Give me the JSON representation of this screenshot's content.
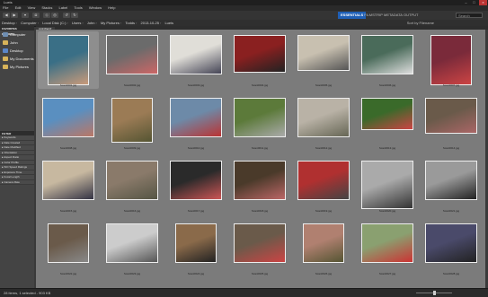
{
  "window": {
    "title": "Lueis",
    "minimize": "–",
    "maximize": "□",
    "close": "×"
  },
  "menu": [
    "File",
    "Edit",
    "View",
    "Stacks",
    "Label",
    "Tools",
    "Window",
    "Help"
  ],
  "toolbar": {
    "workspaces": [
      "ESSENTIALS",
      "FILMSTRIP",
      "METADATA",
      "OUTPUT"
    ],
    "search_placeholder": "Search"
  },
  "path": [
    "Desktop",
    "Computer",
    "Local Disk (C:)",
    "Users",
    "John",
    "My Pictures",
    "Todds",
    "2013-10-25",
    "Lueis"
  ],
  "sort": {
    "label": "Sort by Filename"
  },
  "left_panel": {
    "tabs": [
      "FAVORITES",
      "FOLDERS"
    ],
    "favorites": [
      {
        "label": "Computer",
        "color": "#6f8fb3"
      },
      {
        "label": "John",
        "color": "#d7b35a"
      },
      {
        "label": "Desktop",
        "color": "#5a86c8"
      },
      {
        "label": "My Documents",
        "color": "#d7b35a"
      },
      {
        "label": "My Pictures",
        "color": "#d7b35a"
      }
    ],
    "lower_tabs": [
      "FILTER",
      "COLLECTIONS"
    ],
    "filters": [
      "Keywords",
      "Date Created",
      "Date Modified",
      "Orientation",
      "Aspect Ratio",
      "Color Profile",
      "ISO Speed Ratings",
      "Exposure Time",
      "Focal Length",
      "Camera Raw"
    ]
  },
  "content": {
    "tab": "CONTENT"
  },
  "thumbnails": [
    {
      "name": "Scan0001.jpg",
      "w": 46,
      "h": 56,
      "colors": [
        "#3a6f86",
        "#c99a7a"
      ],
      "selected": true
    },
    {
      "name": "Scan0002.jpg",
      "w": 58,
      "h": 44,
      "colors": [
        "#6b6b6b",
        "#c66"
      ]
    },
    {
      "name": "Scan0003.jpg",
      "w": 58,
      "h": 44,
      "colors": [
        "#e0ded8",
        "#445"
      ]
    },
    {
      "name": "Scan0004.jpg",
      "w": 58,
      "h": 42,
      "colors": [
        "#8a2020",
        "#222"
      ]
    },
    {
      "name": "Scan0005.jpg",
      "w": 58,
      "h": 40,
      "colors": [
        "#c8c0b0",
        "#555"
      ]
    },
    {
      "name": "Scan0006.jpg",
      "w": 58,
      "h": 44,
      "colors": [
        "#4a6b5a",
        "#ddd"
      ]
    },
    {
      "name": "Scan0007.jpg",
      "w": 46,
      "h": 56,
      "colors": [
        "#7a2a3a",
        "#c44"
      ]
    },
    {
      "name": "Scan0008.jpg",
      "w": 58,
      "h": 44,
      "colors": [
        "#5a8fc0",
        "#b76"
      ]
    },
    {
      "name": "Scan0009.jpg",
      "w": 46,
      "h": 50,
      "colors": [
        "#9b7b55",
        "#553"
      ]
    },
    {
      "name": "Scan0010.jpg",
      "w": 58,
      "h": 44,
      "colors": [
        "#6d8aa8",
        "#b33"
      ]
    },
    {
      "name": "Scan0011.jpg",
      "w": 58,
      "h": 44,
      "colors": [
        "#5c7a3a",
        "#aaa"
      ]
    },
    {
      "name": "Scan0012.jpg",
      "w": 58,
      "h": 44,
      "colors": [
        "#b9b2a6",
        "#665"
      ]
    },
    {
      "name": "Scan0013.jpg",
      "w": 58,
      "h": 36,
      "colors": [
        "#3a6a2a",
        "#c44"
      ]
    },
    {
      "name": "Scan0014.jpg",
      "w": 58,
      "h": 40,
      "colors": [
        "#6a5a4a",
        "#a66"
      ]
    },
    {
      "name": "Scan0015.jpg",
      "w": 58,
      "h": 44,
      "colors": [
        "#c7b8a0",
        "#334"
      ]
    },
    {
      "name": "Scan0016.jpg",
      "w": 58,
      "h": 44,
      "colors": [
        "#8a7a6a",
        "#554"
      ]
    },
    {
      "name": "Scan0017.jpg",
      "w": 58,
      "h": 44,
      "colors": [
        "#2a2a2a",
        "#c55"
      ]
    },
    {
      "name": "Scan0018.jpg",
      "w": 58,
      "h": 44,
      "colors": [
        "#4a3a2a",
        "#b66"
      ]
    },
    {
      "name": "Scan0019.jpg",
      "w": 58,
      "h": 44,
      "colors": [
        "#b03030",
        "#444"
      ]
    },
    {
      "name": "Scan0020.jpg",
      "w": 58,
      "h": 54,
      "colors": [
        "#aaa",
        "#333"
      ]
    },
    {
      "name": "Scan0021.jpg",
      "w": 58,
      "h": 44,
      "colors": [
        "#9a9a9a",
        "#222"
      ]
    },
    {
      "name": "Scan0022.jpg",
      "w": 46,
      "h": 44,
      "colors": [
        "#6a5a4a",
        "#888"
      ]
    },
    {
      "name": "Scan0023.jpg",
      "w": 58,
      "h": 44,
      "colors": [
        "#ccc",
        "#555"
      ]
    },
    {
      "name": "Scan0024.jpg",
      "w": 46,
      "h": 44,
      "colors": [
        "#8a6a4a",
        "#222"
      ]
    },
    {
      "name": "Scan0025.jpg",
      "w": 58,
      "h": 44,
      "colors": [
        "#6a5a4a",
        "#c44"
      ]
    },
    {
      "name": "Scan0026.jpg",
      "w": 46,
      "h": 44,
      "colors": [
        "#b08070",
        "#553"
      ]
    },
    {
      "name": "Scan0027.jpg",
      "w": 58,
      "h": 44,
      "colors": [
        "#8aa070",
        "#c33"
      ]
    },
    {
      "name": "Scan0028.jpg",
      "w": 58,
      "h": 44,
      "colors": [
        "#4a4a6a",
        "#222"
      ]
    }
  ],
  "status": {
    "text": "28 items, 1 selected - 903 KB"
  }
}
